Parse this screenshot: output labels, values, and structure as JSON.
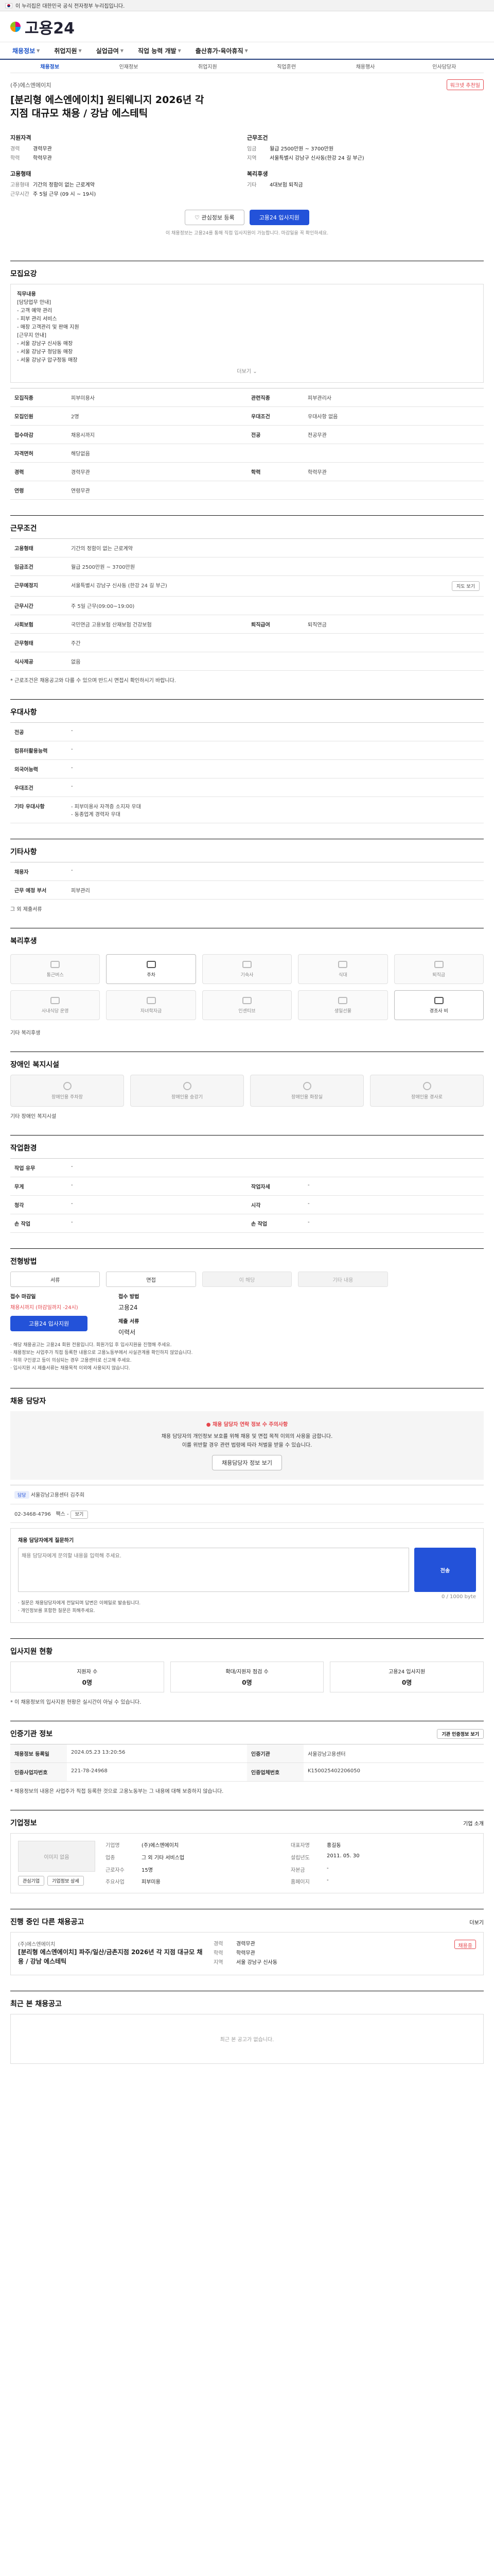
{
  "gov": "이 누리집은 대한민국 공식 전자정부 누리집입니다.",
  "logo": "고용24",
  "gnb": [
    "채용정보",
    "취업지원",
    "실업급여",
    "직업 능력 개발",
    "출산휴가·육아휴직"
  ],
  "steps": [
    "채용정보",
    "인재정보",
    "취업지원",
    "직업훈련",
    "채용행사",
    "인사담당자"
  ],
  "head": {
    "company": "(주)에스엔에이치",
    "badge": "워크넷 추천일",
    "title": "[분리형 에스엔에이치] 원티웨니지 2026년 각 지점 대규모 채용 / 강남 에스테틱",
    "left_sec": "지원자격",
    "right_sec": "근무조건",
    "left": [
      [
        "경력",
        "경력무관"
      ],
      [
        "학력",
        "학력무관"
      ]
    ],
    "right": [
      [
        "임금",
        "월급 2500만원 ~ 3700만원"
      ],
      [
        "지역",
        "서울특별시 강남구 신사동(한강 24 길 부근)"
      ]
    ],
    "left2_sec": "고용형태",
    "right2_sec": "복리후생",
    "left2": [
      [
        "고용형태",
        "기간의 정함이 없는 근로계약"
      ],
      [
        "근무시간",
        "주 5일 근무 (09 시 ~ 19시)"
      ]
    ],
    "right2": [
      [
        "기타",
        "4대보험 퇴직금"
      ]
    ],
    "save": "관심정보 등록",
    "apply": "고용24 입사지원",
    "note": "이 채용정보는 고용24를 통해 직접 입사지원이 가능합니다. 마감일을 꼭 확인하세요."
  },
  "recruit": {
    "title": "모집요강",
    "duty_title": "직무내용",
    "duty": [
      "[담당업무 안내]",
      "- 고객 예약 관리",
      "- 피부 관리 서비스",
      "- 매장 고객관리 및 판매 지원",
      "[근무지 안내]",
      "- 서울 강남구 신사동 매장",
      "- 서울 강남구 청담동 매장",
      "- 서울 강남구 압구정동 매장"
    ],
    "more": "더보기",
    "rows": [
      [
        "모집직종",
        "피부미용사",
        "관련직종",
        "피부관리사"
      ],
      [
        "모집인원",
        "2명",
        "우대조건",
        "우대사항 없음"
      ],
      [
        "접수마감",
        "채용시까지",
        "전공",
        "전공무관"
      ],
      [
        "자격면허",
        "해당없음",
        "",
        ""
      ],
      [
        "경력",
        "경력무관",
        "학력",
        "학력무관"
      ],
      [
        "연령",
        "연령무관",
        "",
        ""
      ]
    ]
  },
  "conditions": {
    "title": "근무조건",
    "rows": [
      [
        "고용형태",
        "기간의 정함이 없는 근로계약"
      ],
      [
        "임금조건",
        "월급 2500만원 ~ 3700만원"
      ],
      [
        "근무예정지",
        "서울특별시 강남구 신사동 (한강 24 길 부근)"
      ],
      [
        "근무시간",
        "주 5일 근무(09:00~19:00)"
      ],
      [
        "사회보험",
        "국민연금 고용보험 산재보험 건강보험"
      ],
      [
        "퇴직급여",
        "퇴직연금"
      ],
      [
        "근무형태",
        "주간"
      ],
      [
        "식사제공",
        "없음"
      ]
    ],
    "map": "지도 보기",
    "note": "* 근로조건은 채용공고와 다를 수 있으며 반드시 면접시 확인하시기 바랍니다."
  },
  "pref": {
    "title": "우대사항",
    "rows": [
      [
        "전공",
        "-"
      ],
      [
        "컴퓨터활용능력",
        "-"
      ],
      [
        "외국어능력",
        "-"
      ],
      [
        "우대조건",
        "-"
      ],
      [
        "기타 우대사항",
        "- 피부미용사 자격증 소지자 우대\n- 동종업계 경력자 우대"
      ]
    ]
  },
  "etc": {
    "title": "기타사항",
    "rows": [
      [
        "채용자",
        "-"
      ],
      [
        "근무 예정 부서",
        "피부관리"
      ]
    ],
    "extra": "그 외 제출서류"
  },
  "welfare": {
    "title": "복리후생",
    "items": [
      "통근버스",
      "주차",
      "기숙사",
      "식대",
      "퇴직금",
      "사내식당 운영",
      "자녀학자금",
      "인센티브",
      "생일선물",
      "경조사 비"
    ],
    "other_label": "기타 복리후생"
  },
  "disabled": {
    "title": "장애인 복지시설",
    "items": [
      "장애인용 주차장",
      "장애인용 승강기",
      "장애인용 화장실",
      "장애인용 경사로"
    ],
    "other_label": "기타 장애인 복지시설"
  },
  "env": {
    "title": "작업환경",
    "rows": [
      [
        "작업 유무",
        "-"
      ],
      [
        "무게",
        "-",
        "작업자세",
        "-"
      ],
      [
        "청각",
        "-",
        "시각",
        "-"
      ],
      [
        "손 작업",
        "-",
        "손 작업",
        "-"
      ]
    ]
  },
  "process": {
    "title": "전형방법",
    "tabs": [
      "서류",
      "면접",
      "이 해당",
      "기타 내용"
    ],
    "recv_h1": "접수 마감일",
    "recv_v1": "채용시까지 (마감일까지 -24시)",
    "recv_h2": "접수 방법",
    "recv_v2": "고용24",
    "recv_h3": "제출 서류",
    "recv_v3": "이력서",
    "apply": "고용24 입사지원",
    "bullets": [
      "· 해당 채용공고는 고용24 회원 전용입니다. 회원가입 후 입사지원을 진행해 주세요.",
      "· 채용정보는 사업주가 직접 등록한 내용으로 고용노동부에서 사실관계를 확인하지 않았습니다.",
      "· 허위 구인광고 등이 의심되는 경우 고용센터로 신고해 주세요.",
      "· 입사지원 시 제출서류는 채용목적 이외에 사용되지 않습니다."
    ]
  },
  "manager": {
    "title": "채용 담당자",
    "warn_t": "채용 담당자 연락 정보 수 주의사항",
    "warn": "채용 담당자의 개인정보 보호를 위해 채용 및 면접 목적 이외의 사용을 금합니다.",
    "warn2": "이를 위반할 경우 관련 법령에 따라 처벌을 받을 수 있습니다.",
    "btn": "채용담당자 정보 보기",
    "org": "서울강남고용센터 김주희",
    "tel": "02-3468-4796",
    "fax": "-",
    "open": "보기"
  },
  "inquiry": {
    "title": "채용 담당자에게 질문하기",
    "placeholder": "채용 담당자에게 문의할 내용을 입력해 주세요.",
    "count": "0 / 1000 byte",
    "send": "전송",
    "notes": [
      "· 질문은 채용담당자에게 전달되며 답변은 이메일로 발송됩니다.",
      "· 개인정보를 포함한 질문은 피해주세요."
    ]
  },
  "status": {
    "title": "입사지원 현황",
    "items": [
      [
        "지원자 수",
        "0명"
      ],
      [
        "확대/지원자 점검 수",
        "0명"
      ],
      [
        "고용24 입사지원",
        "0명"
      ]
    ],
    "note": "* 이 채용정보의 입사지원 현황은 실시간이 아닐 수 있습니다."
  },
  "auth": {
    "title": "인증기관 정보",
    "btn": "기관 인증정보 보기",
    "rows": [
      [
        "채용정보 등록일",
        "2024.05.23 13:20:56",
        "인증기관",
        "서울강남고용센터"
      ],
      [
        "인증사업자번호",
        "221-78-24968",
        "인증업체번호",
        "K150025402206050"
      ]
    ],
    "note": "* 채용정보의 내용은 사업주가 직접 등록한 것으로 고용노동부는 그 내용에 대해 보증하지 않습니다."
  },
  "corp": {
    "title": "기업정보",
    "more": "기업 소개",
    "logo": "이미지 없음",
    "rows": [
      [
        "기업명",
        "(주)에스엔에이치",
        "대표자명",
        "홍길동"
      ],
      [
        "업종",
        "그 외 기타 서비스업",
        "설립년도",
        "2011. 05. 30"
      ],
      [
        "근로자수",
        "15명",
        "자본금",
        "-"
      ],
      [
        "주요사업",
        "피부미용",
        "홈페이지",
        "-"
      ]
    ],
    "btns": [
      "관심기업",
      "기업정보 상세"
    ]
  },
  "similar": {
    "title": "진행 중인 다른 채용공고",
    "more": "더보기",
    "co": "(주)에스엔에이치",
    "t": "[분리형 에스엔에이치] 파주/일산/금촌지점 2026년 각 지점 대규모 채용 / 강남 에스테틱",
    "k": [
      [
        "경력",
        "경력무관"
      ],
      [
        "학력",
        "학력무관"
      ],
      [
        "지역",
        "서울 강남구 신사동"
      ]
    ],
    "mark": "채용중"
  },
  "recent": {
    "title": "최근 본 채용공고",
    "empty": "최근 본 공고가 없습니다."
  }
}
